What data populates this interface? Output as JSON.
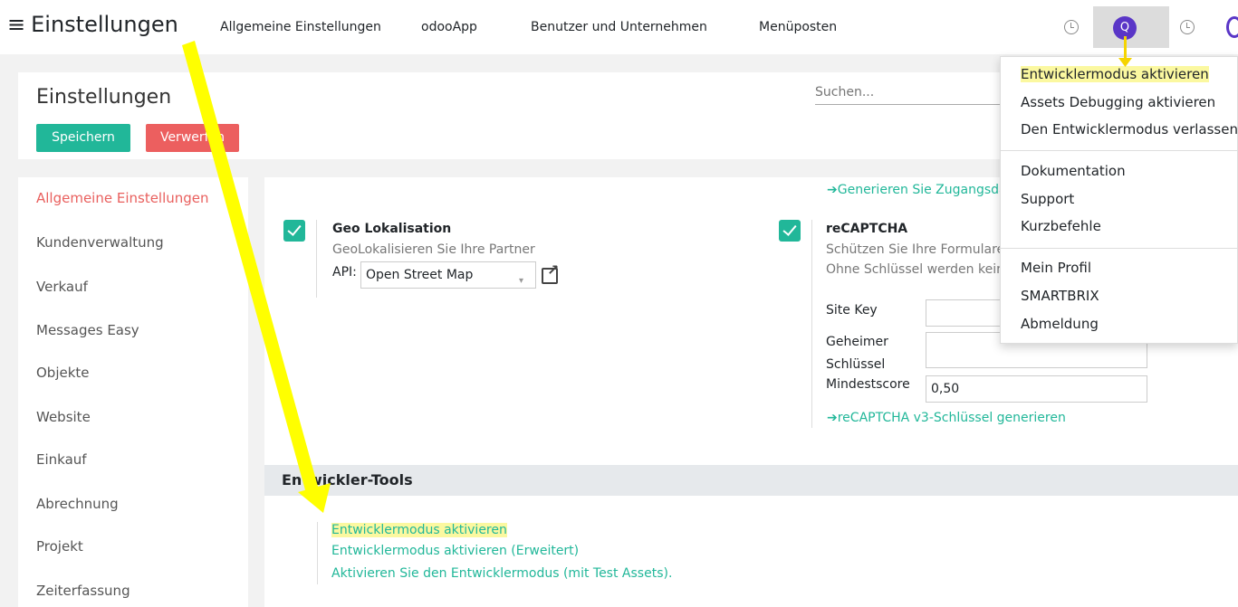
{
  "topbar": {
    "title": "Einstellungen",
    "menu_icon": "hamburger-icon",
    "nav": [
      "Allgemeine Einstellungen",
      "odooApp",
      "Benutzer und Unternehmen",
      "Menüposten"
    ],
    "avatar_letter": "Q",
    "accent": "#5a36c7"
  },
  "control_panel": {
    "title": "Einstellungen",
    "save": "Speichern",
    "discard": "Verwerfen",
    "search_placeholder": "Suchen..."
  },
  "sidebar": {
    "items": [
      "Allgemeine Einstellungen",
      "Kundenverwaltung",
      "Verkauf",
      "Messages Easy",
      "Objekte",
      "Website",
      "Einkauf",
      "Abrechnung",
      "Projekt",
      "Zeiterfassung"
    ]
  },
  "geo": {
    "title": "Geo Lokalisation",
    "desc": "GeoLokalisieren Sie Ihre Partner",
    "api_label": "API:",
    "api_value": "Open Street Map"
  },
  "recaptcha": {
    "top_link": "➔Generieren Sie Zugangsdaten",
    "title": "reCAPTCHA",
    "desc1": "Schützen Sie Ihre Formulare",
    "desc2": "Ohne Schlüssel werden keine",
    "site_key_label": "Site Key",
    "secret_label_1": "Geheimer",
    "secret_label_2": "Schlüssel",
    "min_score_label": "Mindestscore",
    "min_score_value": "0,50",
    "gen_link": "➔reCAPTCHA v3-Schlüssel generieren"
  },
  "dev_tools": {
    "title": "Entwickler-Tools",
    "links": [
      "Entwicklermodus aktivieren",
      "Entwicklermodus aktivieren (Erweitert)",
      "Aktivieren Sie den Entwicklermodus (mit Test Assets)."
    ]
  },
  "dropdown": {
    "items": [
      "Entwicklermodus aktivieren",
      "Assets Debugging aktivieren",
      "Den Entwicklermodus verlassen",
      "Dokumentation",
      "Support",
      "Kurzbefehle",
      "Mein Profil",
      "SMARTBRIX",
      "Abmeldung"
    ]
  },
  "colors": {
    "primary": "#21b799",
    "danger": "#ec5f5f",
    "highlight": "#fbf8a0",
    "annotation_arrow": "#ffff00"
  }
}
